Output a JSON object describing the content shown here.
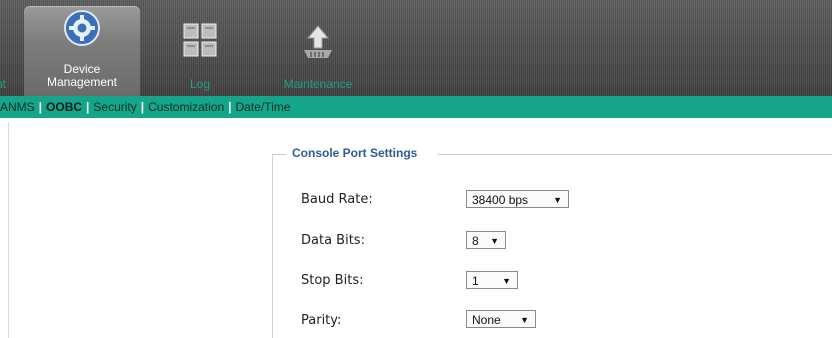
{
  "nav": {
    "prev_partial": "ent",
    "active": {
      "line1": "Device",
      "line2": "Management",
      "icon": "gear-icon"
    },
    "log": {
      "label": "Log",
      "icon": "grid-icon"
    },
    "maintenance": {
      "label": "Maintenance",
      "icon": "upload-icon"
    }
  },
  "subnav": {
    "items": [
      "ANMS",
      "OOBC",
      "Security",
      "Customization",
      "Date/Time"
    ],
    "active": "OOBC"
  },
  "panel": {
    "legend": "Console Port Settings",
    "rows": [
      {
        "label": "Baud Rate:",
        "value": "38400 bps"
      },
      {
        "label": "Data Bits:",
        "value": "8"
      },
      {
        "label": "Stop Bits:",
        "value": "1"
      },
      {
        "label": "Parity:",
        "value": "None"
      }
    ]
  },
  "colors": {
    "subnav_bg": "#15a58a",
    "nav_text": "#1f9e86",
    "legend": "#2f5b95"
  }
}
